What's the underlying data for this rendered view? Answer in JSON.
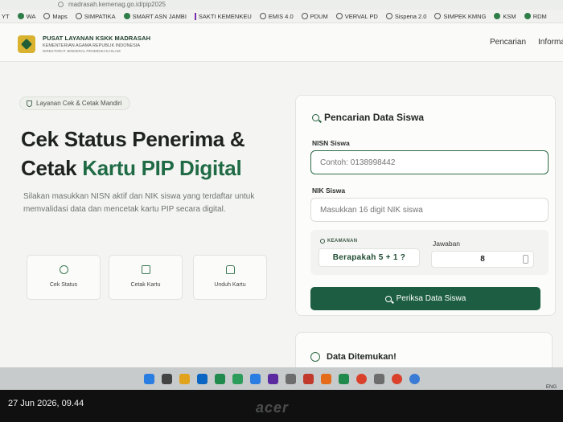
{
  "browser": {
    "url": "madrasah.kemenag.go.id/pip2025",
    "bookmarks": [
      "YT",
      "WA",
      "Maps",
      "SIMPATIKA",
      "SMART ASN JAMBI",
      "SAKTI KEMENKEU",
      "EMIS 4.0",
      "PDUM",
      "VERVAL PD",
      "Sispena 2.0",
      "SIMPEK KMNG",
      "KSM",
      "RDM"
    ]
  },
  "header": {
    "org_name": "PUSAT LAYANAN KSKK MADRASAH",
    "org_sub1": "KEMENTERIAN AGAMA REPUBLIK INDONESIA",
    "org_sub2": "DIREKTORAT JENDERAL PENDIDIKAN ISLAM",
    "nav": [
      "Pencarian",
      "Informa"
    ]
  },
  "hero": {
    "chip": "Layanan Cek & Cetak Mandiri",
    "title_line1": "Cek Status Penerima &",
    "title_line2_plain": "Cetak ",
    "title_line2_accent": "Kartu PIP Digital",
    "description": "Silakan masukkan NISN aktif dan NIK siswa yang terdaftar untuk memvalidasi data dan mencetak kartu PIP secara digital.",
    "features": [
      "Cek Status",
      "Cetak Kartu",
      "Unduh Kartu"
    ]
  },
  "search": {
    "title": "Pencarian Data Siswa",
    "nisn_label": "NISN Siswa",
    "nisn_placeholder": "Contoh: 0138998442",
    "nik_label": "NIK Siswa",
    "nik_placeholder": "Masukkan 16 digit NIK siswa",
    "security_label": "KEAMANAN",
    "question": "Berapakah 5 + 1 ?",
    "answer_label": "Jawaban",
    "answer_value": "8",
    "submit": "Periksa Data Siswa"
  },
  "result": {
    "title": "Data Ditemukan!"
  },
  "os": {
    "tray": "ENG",
    "datetime": "27 Jun 2026, 09.44",
    "brand": "acer"
  },
  "colors": {
    "accent": "#1f6b45",
    "button": "#1d5e42"
  }
}
